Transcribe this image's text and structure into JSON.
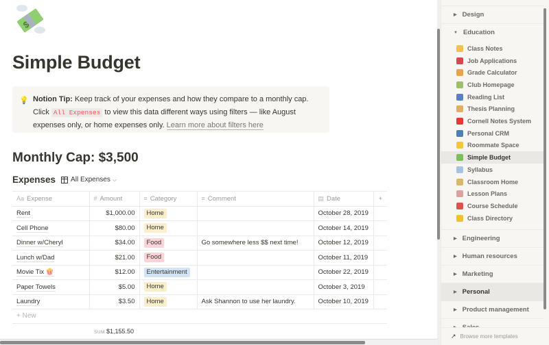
{
  "page": {
    "icon": "money-with-wings-icon",
    "title": "Simple Budget"
  },
  "callout": {
    "icon": "lightbulb-icon",
    "bold": "Notion Tip:",
    "text1": " Keep track of your expenses and how they compare to a monthly cap. Click ",
    "code": "All Expenses",
    "text2": " to view this data different ways using filters — like August expenses only, or home expenses only. ",
    "link": "Learn more about filters here"
  },
  "cap": "Monthly Cap: $3,500",
  "database": {
    "title": "Expenses",
    "view_label": "All Expenses",
    "columns": [
      {
        "icon": "Aa",
        "label": "Expense"
      },
      {
        "icon": "#",
        "label": "Amount"
      },
      {
        "icon": "≡",
        "label": "Category"
      },
      {
        "icon": "≡",
        "label": "Comment"
      },
      {
        "icon": "▤",
        "label": "Date"
      }
    ],
    "add_column": "+",
    "rows": [
      {
        "expense": "Rent",
        "amount": "$1,000.00",
        "category": "Home",
        "comment": "",
        "date": "October 28, 2019"
      },
      {
        "expense": "Cell Phone",
        "amount": "$80.00",
        "category": "Home",
        "comment": "",
        "date": "October 14, 2019"
      },
      {
        "expense": "Dinner w/Cheryl",
        "amount": "$34.00",
        "category": "Food",
        "comment": "Go somewhere less $$ next time!",
        "date": "October 12, 2019"
      },
      {
        "expense": "Lunch w/Dad",
        "amount": "$21.00",
        "category": "Food",
        "comment": "",
        "date": "October 11, 2019"
      },
      {
        "expense": "Movie Tix 🍿",
        "amount": "$12.00",
        "category": "Entertainment",
        "comment": "",
        "date": "October 22, 2019"
      },
      {
        "expense": "Paper Towels",
        "amount": "$5.00",
        "category": "Home",
        "comment": "",
        "date": "October 3, 2019"
      },
      {
        "expense": "Laundry",
        "amount": "$3.50",
        "category": "Home",
        "comment": "Ask Shannon to use her laundry.",
        "date": "October 10, 2019"
      }
    ],
    "new_label": "New",
    "sum_label": "SUM",
    "sum_value": "$1,155.50",
    "tag_colors": {
      "Home": "#fbeecc",
      "Food": "#fbd3d8",
      "Entertainment": "#d3e5f5"
    }
  },
  "sidebar": {
    "sections_top": [
      {
        "label": "Design",
        "expanded": false
      },
      {
        "label": "Education",
        "expanded": true
      }
    ],
    "education_items": [
      {
        "label": "Class Notes",
        "icon": "pencil-icon",
        "color": "#f2c14e"
      },
      {
        "label": "Job Applications",
        "icon": "runner-icon",
        "color": "#d64550"
      },
      {
        "label": "Grade Calculator",
        "icon": "abacus-icon",
        "color": "#e8a44a"
      },
      {
        "label": "Club Homepage",
        "icon": "school-icon",
        "color": "#9bbf6a"
      },
      {
        "label": "Reading List",
        "icon": "books-icon",
        "color": "#5b7fc7"
      },
      {
        "label": "Thesis Planning",
        "icon": "scroll-icon",
        "color": "#e0b060"
      },
      {
        "label": "Cornell Notes System",
        "icon": "pushpin-icon",
        "color": "#e53935"
      },
      {
        "label": "Personal CRM",
        "icon": "card-file-icon",
        "color": "#4f7fb8"
      },
      {
        "label": "Roommate Space",
        "icon": "hand-icon",
        "color": "#f5c542"
      },
      {
        "label": "Simple Budget",
        "icon": "money-with-wings-icon",
        "color": "#7cbf5a",
        "active": true
      },
      {
        "label": "Syllabus",
        "icon": "page-icon",
        "color": "#a9c2e0"
      },
      {
        "label": "Classroom Home",
        "icon": "school-house-icon",
        "color": "#d9b86a"
      },
      {
        "label": "Lesson Plans",
        "icon": "clipboard-icon",
        "color": "#e0a0a0"
      },
      {
        "label": "Course Schedule",
        "icon": "calendar-icon",
        "color": "#d9534f"
      },
      {
        "label": "Class Directory",
        "icon": "contacts-icon",
        "color": "#f0c030"
      }
    ],
    "sections_bottom": [
      {
        "label": "Engineering"
      },
      {
        "label": "Human resources"
      },
      {
        "label": "Marketing"
      },
      {
        "label": "Personal",
        "active": true
      },
      {
        "label": "Product management"
      },
      {
        "label": "Sales"
      }
    ],
    "browse_label": "Browse more templates"
  }
}
